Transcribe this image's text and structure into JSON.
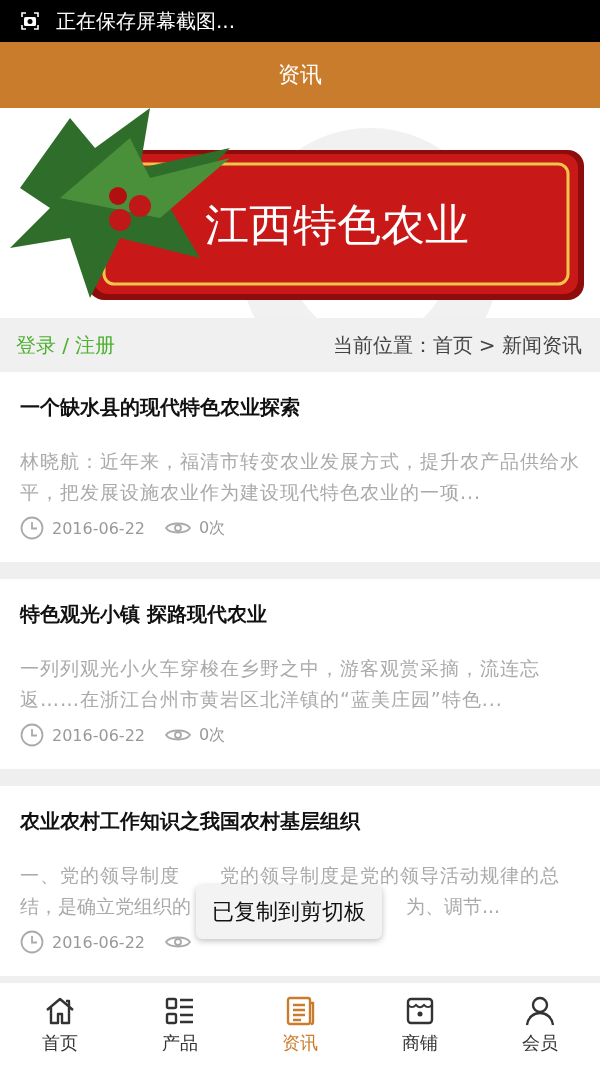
{
  "status_bar": {
    "text": "正在保存屏幕截图..."
  },
  "header": {
    "title": "资讯"
  },
  "banner": {
    "title": "江西特色农业"
  },
  "breadcrumb_bar": {
    "login": "登录 / 注册",
    "location": "当前位置：首页 > 新闻资讯"
  },
  "articles": [
    {
      "title": "一个缺水县的现代特色农业探索",
      "excerpt": "林晓航：近年来，福清市转变农业发展方式，提升农产品供给水平，把发展设施农业作为建设现代特色农业的一项...",
      "date": "2016-06-22",
      "views": "0次"
    },
    {
      "title": "特色观光小镇 探路现代农业",
      "excerpt": "一列列观光小火车穿梭在乡野之中，游客观赏采摘，流连忘返……在浙江台州市黄岩区北洋镇的“蓝美庄园”特色...",
      "date": "2016-06-22",
      "views": "0次"
    },
    {
      "title": "农业农村工作知识之我国农村基层组织",
      "excerpt": "一、党的领导制度　　党的领导制度是党的领导活动规律的总",
      "excerpt_line2": "结，是确立党组织的",
      "excerpt_tail": "为、调节...",
      "date": "2016-06-22"
    }
  ],
  "toast": {
    "text": "已复制到剪切板"
  },
  "bottom_nav": [
    {
      "label": "首页",
      "selected": false
    },
    {
      "label": "产品",
      "selected": false
    },
    {
      "label": "资讯",
      "selected": true
    },
    {
      "label": "商铺",
      "selected": false
    },
    {
      "label": "会员",
      "selected": false
    }
  ]
}
